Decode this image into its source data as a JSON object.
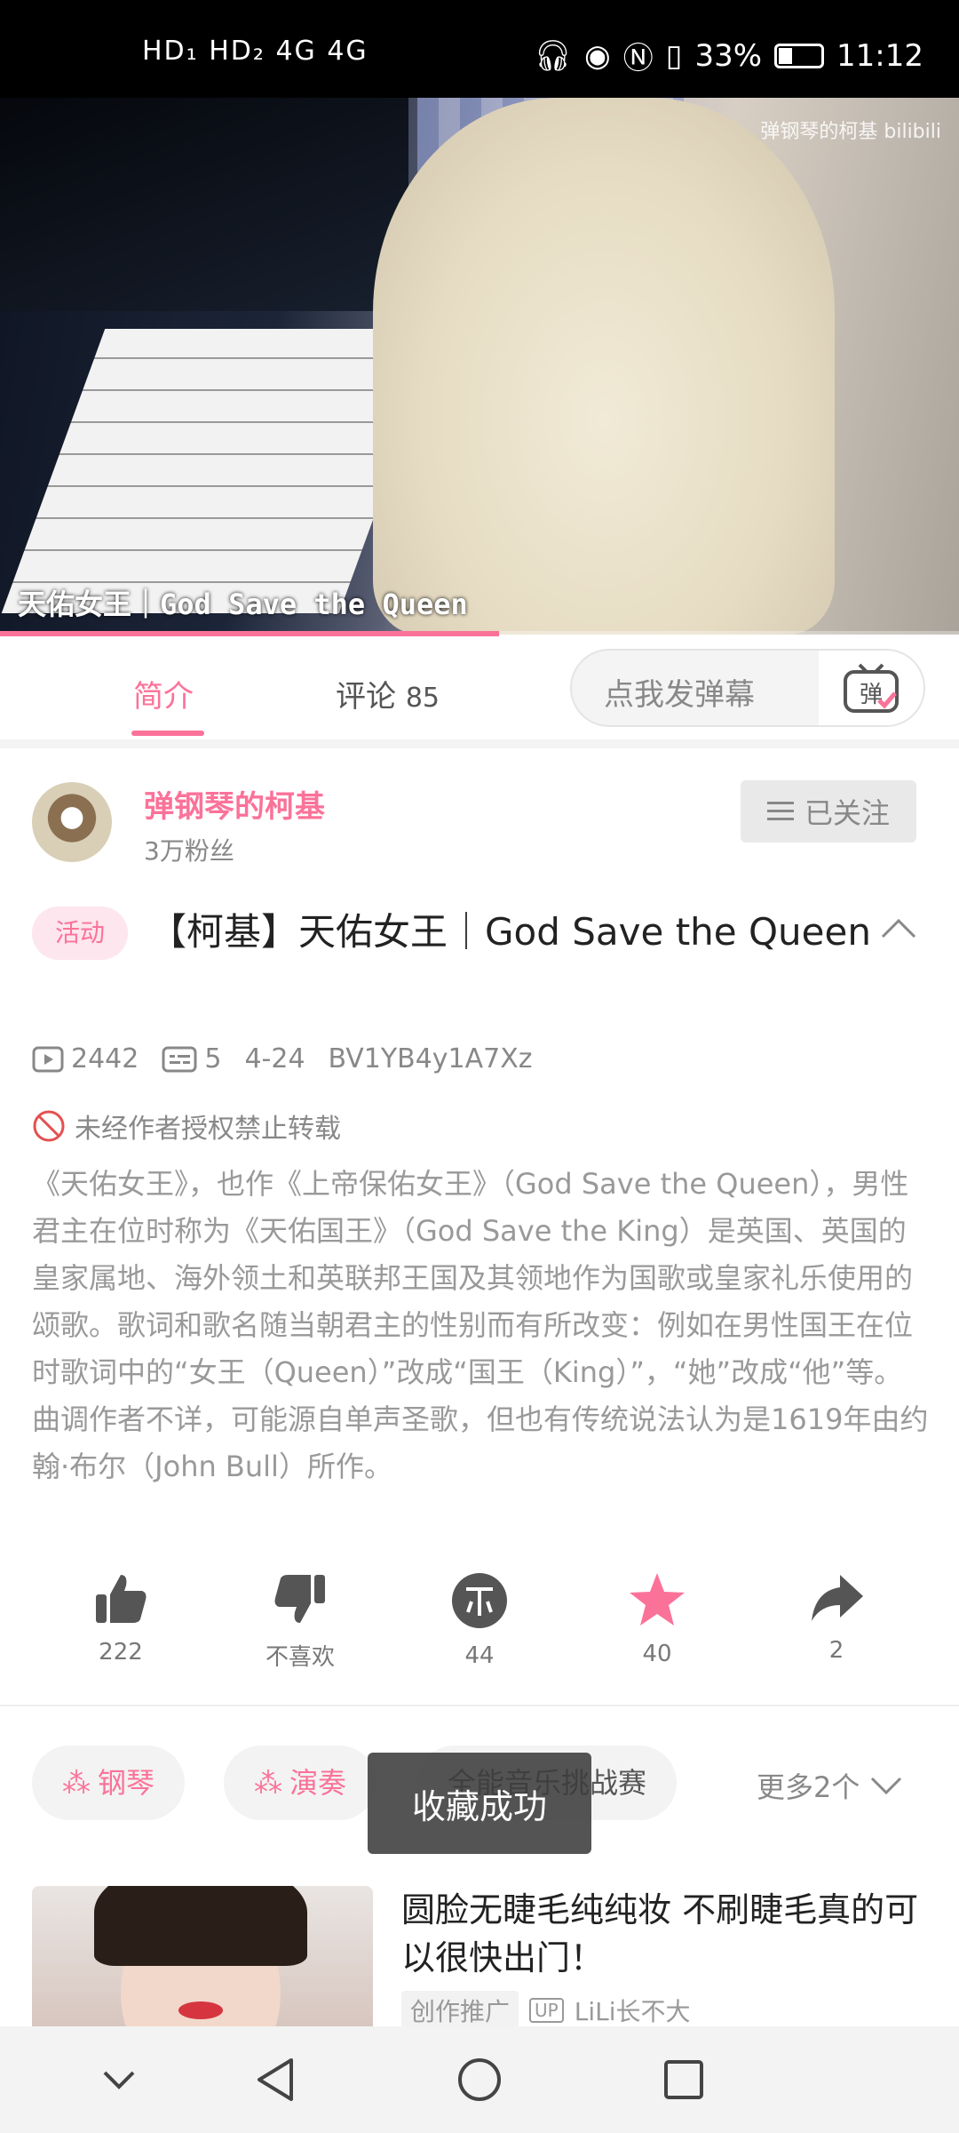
{
  "status_bar": {
    "network": "HD₁ HD₂ 4G 4G",
    "battery_percent": "33%",
    "time": "11:12"
  },
  "video": {
    "overlay_title": "天佑女王｜God Save the Queen",
    "watermark": "弹钢琴的柯基 bilibili",
    "progress_fraction": 0.52
  },
  "tabs": {
    "intro_label": "简介",
    "comments_label": "评论",
    "comments_count": "85",
    "danmaku_placeholder": "点我发弹幕",
    "danmaku_button_label": "弹"
  },
  "uploader": {
    "name": "弹钢琴的柯基",
    "fans": "3万粉丝",
    "follow_label": "已关注"
  },
  "video_info": {
    "activity_tag": "活动",
    "title": "【柯基】天佑女王｜God Save the Queen",
    "views": "2442",
    "danmaku_count": "5",
    "date": "4-24",
    "bvid": "BV1YB4y1A7Xz",
    "no_repost": "未经作者授权禁止转载",
    "description": "《天佑女王》，也作《上帝保佑女王》（God Save the Queen），男性君主在位时称为《天佑国王》（God Save the King）是英国、英国的皇家属地、海外领土和英联邦王国及其领地作为国歌或皇家礼乐使用的颂歌。歌词和歌名随当朝君主的性别而有所改变：例如在男性国王在位时歌词中的“女王（Queen）”改成“国王（King）”，“她”改成“他”等。曲调作者不详，可能源自单声圣歌，但也有传统说法认为是1619年由约翰·布尔（John Bull）所作。"
  },
  "actions": {
    "like": "222",
    "dislike": "不喜欢",
    "coin": "44",
    "favorite": "40",
    "share": "2"
  },
  "tags": {
    "tag1": "钢琴",
    "tag2": "演奏",
    "tag3": "全能音乐挑战赛",
    "more": "更多2个"
  },
  "toast": "收藏成功",
  "recommendation": {
    "title": "圆脸无睫毛纯纯妆 不刷睫毛真的可以很快出门！",
    "badge": "创作推广",
    "up_label": "UP",
    "author": "LiLi长不大"
  },
  "colors": {
    "accent": "#fb7299"
  }
}
